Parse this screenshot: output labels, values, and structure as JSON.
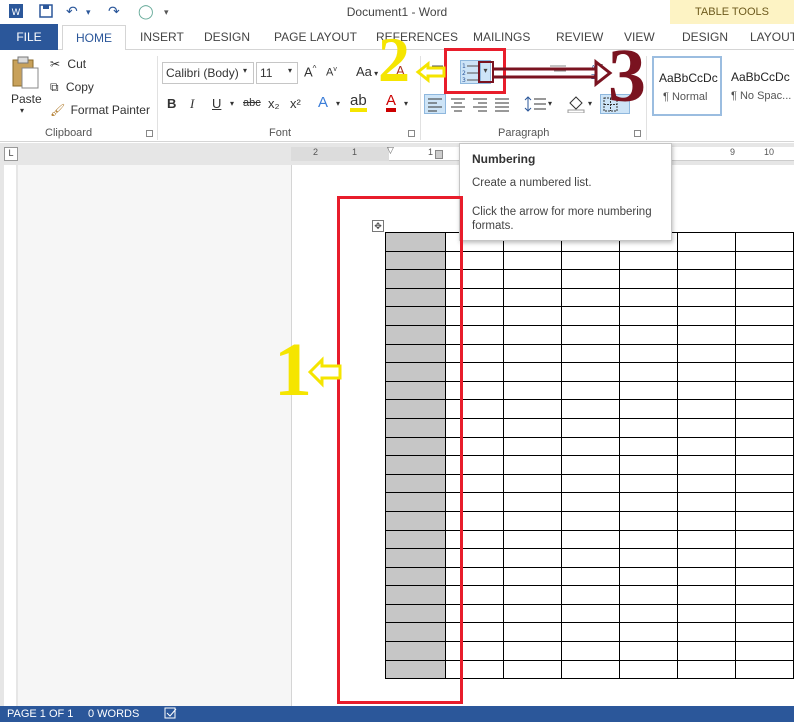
{
  "window": {
    "title": "Document1 - Word",
    "contextual_tab_group": "TABLE TOOLS"
  },
  "tabs": {
    "file": "FILE",
    "home": "HOME",
    "insert": "INSERT",
    "design": "DESIGN",
    "page_layout": "PAGE LAYOUT",
    "references": "REFERENCES",
    "mailings": "MAILINGS",
    "review": "REVIEW",
    "view": "VIEW",
    "table_design": "DESIGN",
    "table_layout": "LAYOUT"
  },
  "clipboard": {
    "paste": "Paste",
    "cut": "Cut",
    "copy": "Copy",
    "format_painter": "Format Painter",
    "group_label": "Clipboard"
  },
  "font": {
    "family": "Calibri (Body)",
    "size": "11",
    "group_label": "Font",
    "bold": "B",
    "italic": "I",
    "underline": "U",
    "strike": "abc",
    "subscript": "x₂",
    "superscript": "x²",
    "change_case": "Aa"
  },
  "paragraph": {
    "group_label": "Paragraph"
  },
  "styles": {
    "normal_preview": "AaBbCcDc",
    "normal_name": "¶ Normal",
    "nospacing_preview": "AaBbCcDc",
    "nospacing_name": "¶ No Spac..."
  },
  "ruler": {
    "h_numbers": [
      "2",
      "1",
      "1",
      "2",
      "9",
      "10"
    ]
  },
  "tooltip": {
    "title": "Numbering",
    "line1": "Create a numbered list.",
    "line2": "Click the arrow for more numbering formats."
  },
  "annotations": {
    "one": "1",
    "two": "2",
    "three": "3"
  },
  "status": {
    "page": "PAGE 1 OF 1",
    "words": "0 WORDS"
  },
  "table": {
    "rows": 24,
    "cols": 7
  },
  "colors": {
    "accent": "#2b579a",
    "annotation_red": "#e81d2b",
    "annotation_yellow": "#f5e500",
    "annotation_maroon": "#7a1320",
    "selection": "#c6c6c6"
  }
}
